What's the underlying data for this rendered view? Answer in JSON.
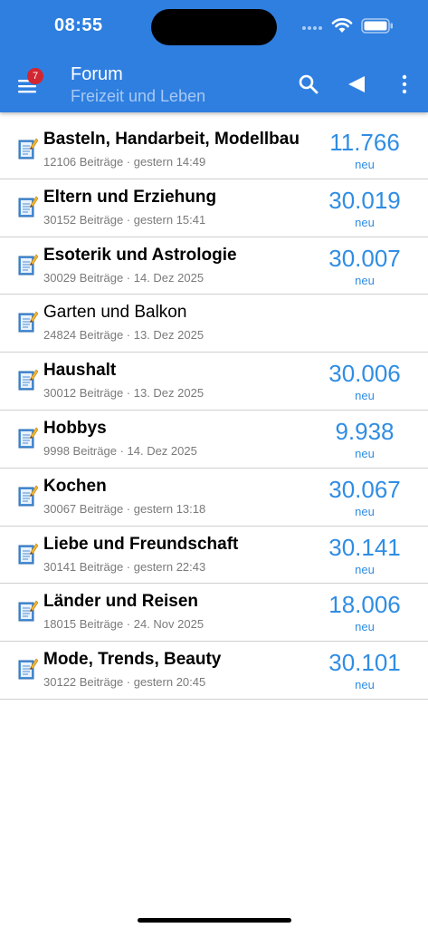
{
  "status": {
    "time": "08:55"
  },
  "header": {
    "badge": "7",
    "title": "Forum",
    "subtitle": "Freizeit und Leben"
  },
  "colors": {
    "accent": "#2f7fe0",
    "count": "#2f8de4",
    "badge": "#d22630"
  },
  "forums": [
    {
      "title": "Basteln, Handarbeit, Modellbau",
      "meta": "12106 Beiträge · gestern 14:49",
      "count": "11.766",
      "new_label": "neu",
      "unread": true
    },
    {
      "title": "Eltern und Erziehung",
      "meta": "30152 Beiträge · gestern 15:41",
      "count": "30.019",
      "new_label": "neu",
      "unread": true
    },
    {
      "title": "Esoterik und Astrologie",
      "meta": "30029 Beiträge · 14. Dez 2025",
      "count": "30.007",
      "new_label": "neu",
      "unread": true
    },
    {
      "title": "Garten und Balkon",
      "meta": "24824 Beiträge · 13. Dez 2025",
      "count": "",
      "new_label": "",
      "unread": false
    },
    {
      "title": "Haushalt",
      "meta": "30012 Beiträge · 13. Dez 2025",
      "count": "30.006",
      "new_label": "neu",
      "unread": true
    },
    {
      "title": "Hobbys",
      "meta": "9998 Beiträge · 14. Dez 2025",
      "count": "9.938",
      "new_label": "neu",
      "unread": true
    },
    {
      "title": "Kochen",
      "meta": "30067 Beiträge · gestern 13:18",
      "count": "30.067",
      "new_label": "neu",
      "unread": true
    },
    {
      "title": "Liebe und Freundschaft",
      "meta": "30141 Beiträge · gestern 22:43",
      "count": "30.141",
      "new_label": "neu",
      "unread": true
    },
    {
      "title": "Länder und Reisen",
      "meta": "18015 Beiträge · 24. Nov 2025",
      "count": "18.006",
      "new_label": "neu",
      "unread": true
    },
    {
      "title": "Mode, Trends, Beauty",
      "meta": "30122 Beiträge · gestern 20:45",
      "count": "30.101",
      "new_label": "neu",
      "unread": true
    }
  ]
}
